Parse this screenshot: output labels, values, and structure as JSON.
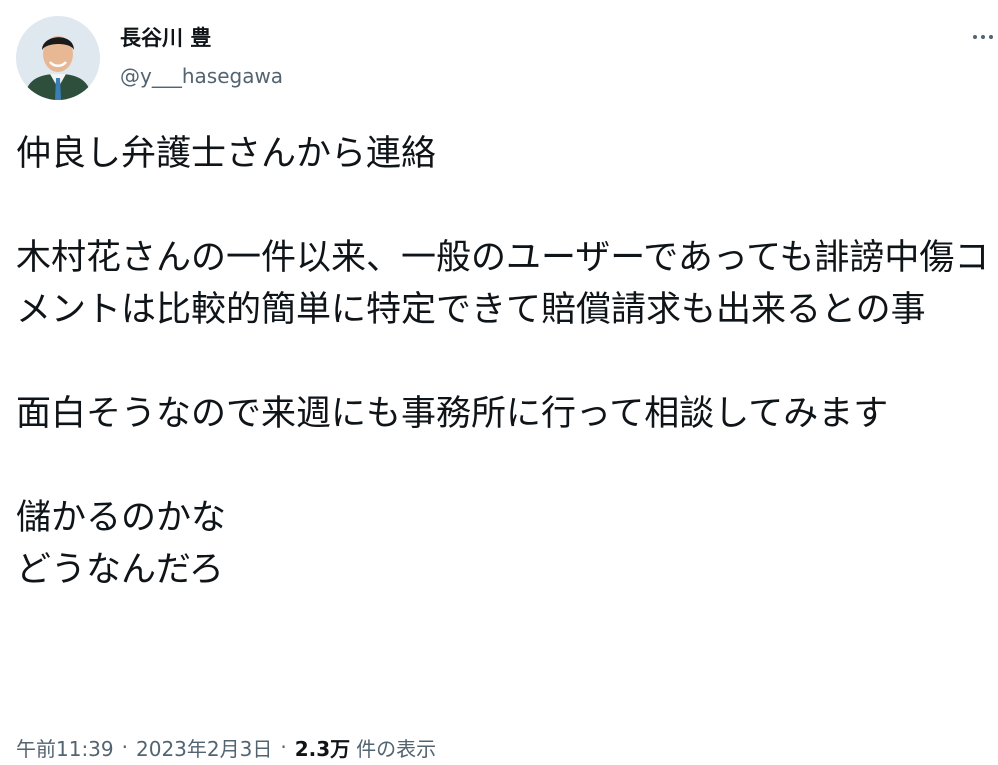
{
  "author": {
    "name": "長谷川 豊",
    "handle": "@y___hasegawa"
  },
  "icons": {
    "avatar": "profile-photo",
    "more": "more-horizontal-icon"
  },
  "tweet": {
    "paragraphs": [
      "仲良し弁護士さんから連絡",
      "木村花さんの一件以来、一般のユーザーであっても誹謗中傷コメントは比較的簡単に特定できて賠償請求も出来るとの事",
      "面白そうなので来週にも事務所に行って相談してみます",
      "儲かるのかな\nどうなんだろ"
    ]
  },
  "meta": {
    "time": "午前11:39",
    "separator": "·",
    "date": "2023年2月3日",
    "views_count": "2.3万",
    "views_label": "件の表示"
  },
  "colors": {
    "text_primary": "#0f1419",
    "text_secondary": "#536471",
    "background": "#ffffff"
  }
}
